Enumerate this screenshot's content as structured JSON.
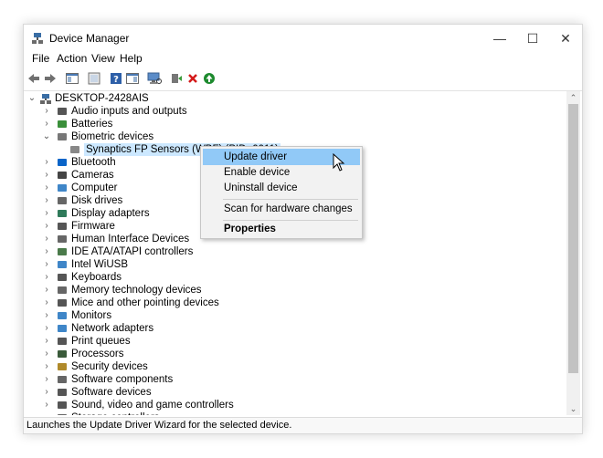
{
  "window": {
    "title": "Device Manager"
  },
  "window_controls": {
    "minimize": "—",
    "maximize": "☐",
    "close": "✕"
  },
  "menu": [
    "File",
    "Action",
    "View",
    "Help"
  ],
  "tree": {
    "root": "DESKTOP-2428AIS",
    "items": [
      {
        "label": "Audio inputs and outputs",
        "icon": "speaker-icon",
        "expanded": false
      },
      {
        "label": "Batteries",
        "icon": "battery-icon",
        "expanded": false
      },
      {
        "label": "Biometric devices",
        "icon": "fingerprint-icon",
        "expanded": true
      },
      {
        "label": "Synaptics FP Sensors (WBF) (PID=0011)",
        "icon": "fingerprint-device-icon",
        "child": true,
        "selected": true
      },
      {
        "label": "Bluetooth",
        "icon": "bluetooth-icon",
        "expanded": false
      },
      {
        "label": "Cameras",
        "icon": "camera-icon",
        "expanded": false
      },
      {
        "label": "Computer",
        "icon": "computer-icon",
        "expanded": false
      },
      {
        "label": "Disk drives",
        "icon": "disk-drive-icon",
        "expanded": false
      },
      {
        "label": "Display adapters",
        "icon": "display-adapter-icon",
        "expanded": false
      },
      {
        "label": "Firmware",
        "icon": "firmware-icon",
        "expanded": false
      },
      {
        "label": "Human Interface Devices",
        "icon": "hid-icon",
        "expanded": false
      },
      {
        "label": "IDE ATA/ATAPI controllers",
        "icon": "ide-controller-icon",
        "expanded": false
      },
      {
        "label": "Intel WiUSB",
        "icon": "monitor-icon",
        "expanded": false
      },
      {
        "label": "Keyboards",
        "icon": "keyboard-icon",
        "expanded": false
      },
      {
        "label": "Memory technology devices",
        "icon": "memory-icon",
        "expanded": false
      },
      {
        "label": "Mice and other pointing devices",
        "icon": "mouse-icon",
        "expanded": false
      },
      {
        "label": "Monitors",
        "icon": "monitor-icon",
        "expanded": false
      },
      {
        "label": "Network adapters",
        "icon": "network-adapter-icon",
        "expanded": false
      },
      {
        "label": "Print queues",
        "icon": "printer-icon",
        "expanded": false
      },
      {
        "label": "Processors",
        "icon": "processor-icon",
        "expanded": false
      },
      {
        "label": "Security devices",
        "icon": "security-device-icon",
        "expanded": false
      },
      {
        "label": "Software components",
        "icon": "software-component-icon",
        "expanded": false
      },
      {
        "label": "Software devices",
        "icon": "software-device-icon",
        "expanded": false
      },
      {
        "label": "Sound, video and game controllers",
        "icon": "speaker-icon",
        "expanded": false
      },
      {
        "label": "Storage controllers",
        "icon": "storage-controller-icon",
        "expanded": false
      }
    ]
  },
  "context_menu": {
    "update": "Update driver",
    "enable": "Enable device",
    "uninstall": "Uninstall device",
    "scan": "Scan for hardware changes",
    "properties": "Properties"
  },
  "status": "Launches the Update Driver Wizard for the selected device.",
  "colors": {
    "selection": "#cce8ff",
    "menu_highlight": "#91c9f7",
    "accent": "#0078d7"
  }
}
